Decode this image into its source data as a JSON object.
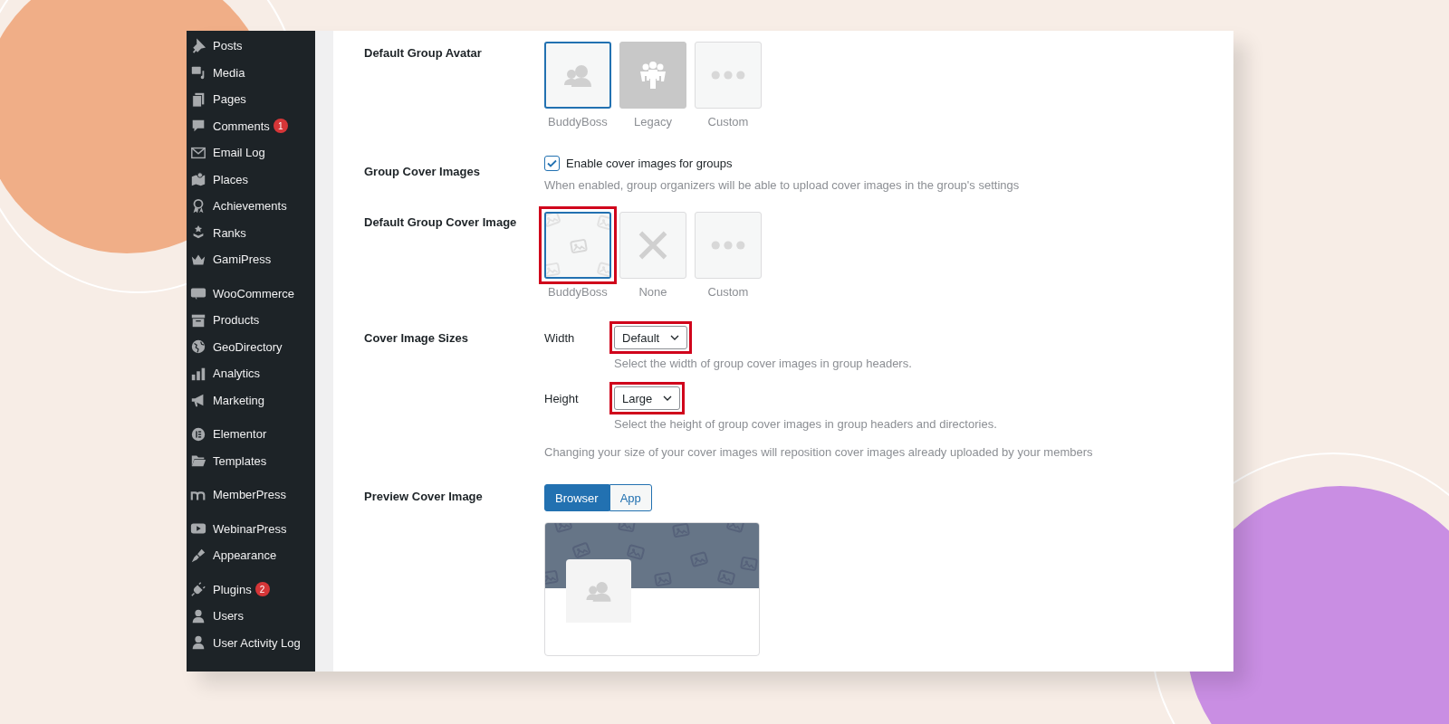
{
  "sidebar": {
    "groups": [
      [
        {
          "label": "Posts"
        },
        {
          "label": "Media"
        },
        {
          "label": "Pages"
        },
        {
          "label": "Comments",
          "badge": "1"
        },
        {
          "label": "Email Log"
        },
        {
          "label": "Places"
        },
        {
          "label": "Achievements"
        },
        {
          "label": "Ranks"
        },
        {
          "label": "GamiPress"
        }
      ],
      [
        {
          "label": "WooCommerce"
        },
        {
          "label": "Products"
        },
        {
          "label": "GeoDirectory"
        },
        {
          "label": "Analytics"
        },
        {
          "label": "Marketing"
        }
      ],
      [
        {
          "label": "Elementor"
        },
        {
          "label": "Templates"
        }
      ],
      [
        {
          "label": "MemberPress"
        }
      ],
      [
        {
          "label": "WebinarPress"
        },
        {
          "label": "Appearance"
        }
      ],
      [
        {
          "label": "Plugins",
          "badge": "2"
        },
        {
          "label": "Users"
        },
        {
          "label": "User Activity Log"
        }
      ]
    ]
  },
  "settings": [
    {
      "kind": "cards",
      "label": "Default Group Avatar",
      "options": [
        {
          "caption": "BuddyBoss",
          "selected": true
        },
        {
          "caption": "Legacy",
          "selected": false
        },
        {
          "caption": "Custom",
          "selected": false
        }
      ]
    },
    {
      "kind": "checkbox",
      "label": "Group Cover Images",
      "checkbox_label": "Enable cover images for groups",
      "checked": true,
      "help": "When enabled, group organizers will be able to upload cover images in the group's settings"
    },
    {
      "kind": "cards",
      "label": "Default Group Cover Image",
      "options": [
        {
          "caption": "BuddyBoss",
          "selected": true,
          "highlighted": true
        },
        {
          "caption": "None",
          "selected": false
        },
        {
          "caption": "Custom",
          "selected": false
        }
      ]
    },
    {
      "kind": "sizes",
      "label": "Cover Image Sizes",
      "selects": [
        {
          "label": "Width",
          "value": "Default",
          "help": "Select the width of group cover images in group headers.",
          "highlighted": true
        },
        {
          "label": "Height",
          "value": "Large",
          "help": "Select the height of group cover images in group headers and directories.",
          "highlighted": true
        }
      ],
      "note": "Changing your size of your cover images will reposition cover images already uploaded by your members"
    },
    {
      "kind": "preview",
      "label": "Preview Cover Image",
      "tabs": [
        {
          "label": "Browser",
          "selected": true
        },
        {
          "label": "App",
          "selected": false
        }
      ]
    }
  ]
}
